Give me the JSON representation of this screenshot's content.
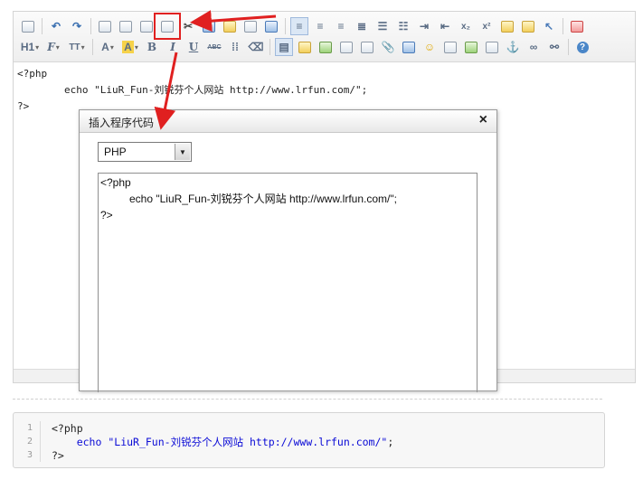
{
  "editor": {
    "content_lines": [
      "<?php",
      "echo \"LiuR_Fun-刘锐芬个人网站 http://www.lrfun.com/\";",
      "?>"
    ],
    "toolbar_row1": [
      {
        "icon": "source-icon"
      },
      {
        "icon": "undo-icon"
      },
      {
        "icon": "redo-icon"
      },
      {
        "icon": "preview-icon"
      },
      {
        "icon": "print-icon"
      },
      {
        "icon": "template-icon"
      },
      {
        "icon": "insert-code-icon"
      },
      {
        "icon": "cut-icon"
      },
      {
        "icon": "copy-icon"
      },
      {
        "icon": "paste-icon"
      },
      {
        "icon": "paste-text-icon"
      },
      {
        "icon": "paste-word-icon"
      },
      {
        "icon": "align-left-icon"
      },
      {
        "icon": "align-center-icon"
      },
      {
        "icon": "align-right-icon"
      },
      {
        "icon": "justify-icon"
      },
      {
        "icon": "ordered-list-icon"
      },
      {
        "icon": "unordered-list-icon"
      },
      {
        "icon": "indent-icon"
      },
      {
        "icon": "outdent-icon"
      },
      {
        "icon": "subscript-icon"
      },
      {
        "icon": "superscript-icon"
      },
      {
        "icon": "clear-format-icon"
      },
      {
        "icon": "select-all-icon"
      },
      {
        "icon": "cursor-icon"
      },
      {
        "icon": "fullscreen-icon"
      }
    ],
    "toolbar_row2": {
      "heading_label": "H1",
      "font_label": "F",
      "size_label": "TT",
      "fore_color_label": "A",
      "back_color_label": "A",
      "bold_label": "B",
      "italic_label": "I",
      "underline_label": "U",
      "strike_label": "ABC"
    }
  },
  "dialog": {
    "title": "插入程序代码",
    "close_label": "×",
    "language_value": "PHP",
    "code_lines": [
      "<?php",
      "echo \"LiuR_Fun-刘锐芬个人网站 http://www.lrfun.com/\";",
      "?>"
    ]
  },
  "preview": {
    "line_numbers": [
      "1",
      "2",
      "3"
    ],
    "line1": "<?php",
    "line2_kw": "echo",
    "line2_str": "\"LiuR_Fun-刘锐芬个人网站 http://www.lrfun.com/\"",
    "line2_end": ";",
    "line3": "?>"
  },
  "colors": {
    "annotation_red": "#e02020",
    "code_blue": "#0a0ad6"
  }
}
